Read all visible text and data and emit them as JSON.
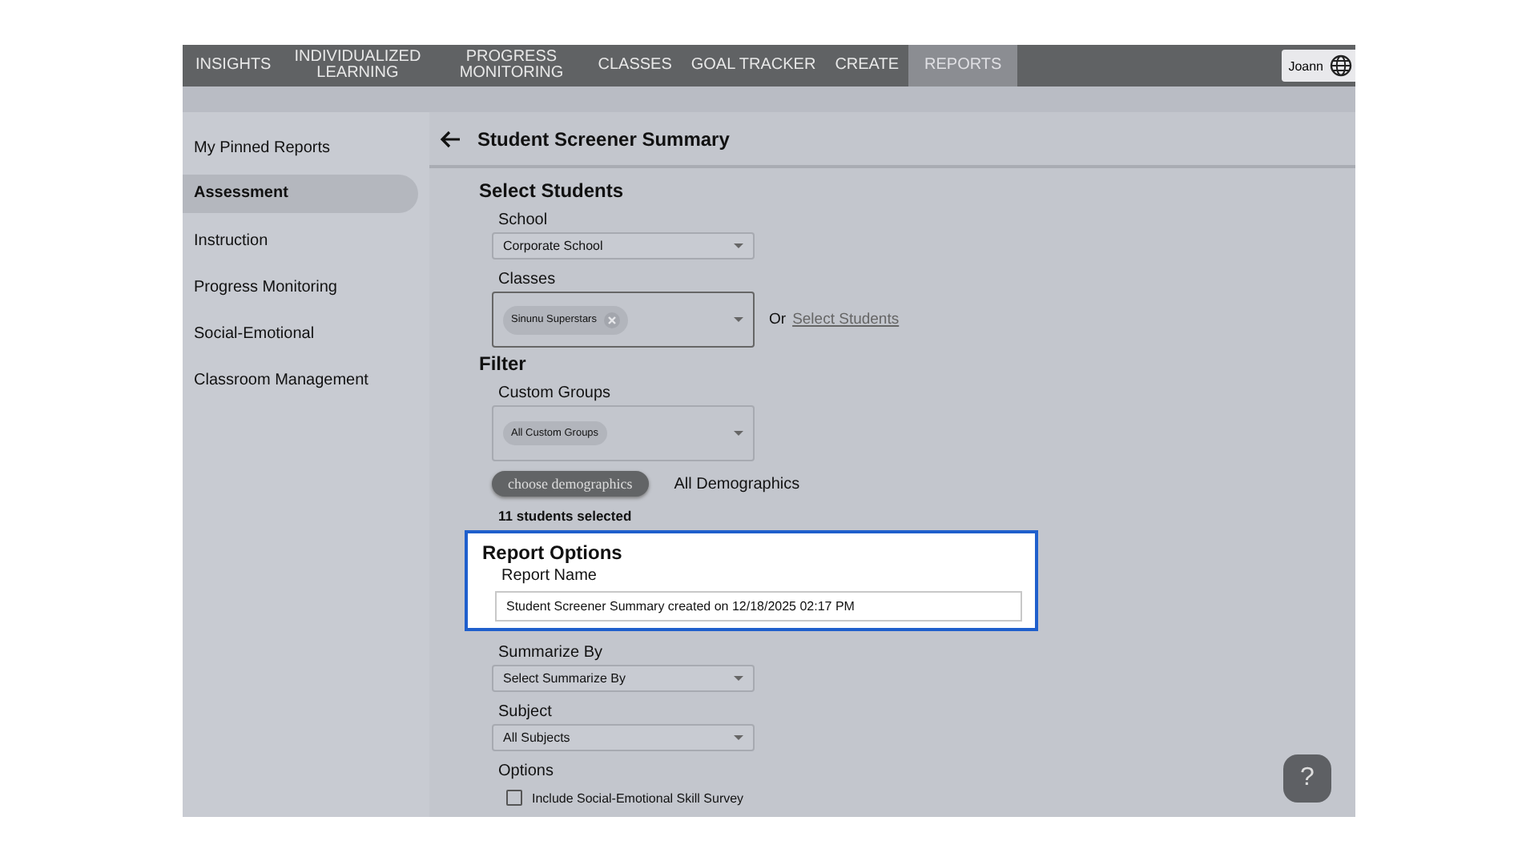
{
  "nav": {
    "tabs": [
      {
        "label": "INSIGHTS",
        "selected": false
      },
      {
        "label": "INDIVIDUALIZED LEARNING",
        "selected": false
      },
      {
        "label": "PROGRESS MONITORING",
        "selected": false
      },
      {
        "label": "CLASSES",
        "selected": false
      },
      {
        "label": "GOAL TRACKER",
        "selected": false
      },
      {
        "label": "CREATE",
        "selected": false
      },
      {
        "label": "REPORTS",
        "selected": true
      }
    ],
    "user": "Joann"
  },
  "sidebar": {
    "items": [
      {
        "label": "My Pinned Reports",
        "selected": false
      },
      {
        "label": "Assessment",
        "selected": true
      },
      {
        "label": "Instruction",
        "selected": false
      },
      {
        "label": "Progress Monitoring",
        "selected": false
      },
      {
        "label": "Social-Emotional",
        "selected": false
      },
      {
        "label": "Classroom Management",
        "selected": false
      }
    ]
  },
  "page_title": "Student Screener Summary",
  "select_students": {
    "heading": "Select Students",
    "school": {
      "label": "School",
      "value": "Corporate School"
    },
    "classes": {
      "label": "Classes",
      "chip": "Sinunu Superstars"
    },
    "or_text": "Or",
    "select_link": "Select Students"
  },
  "filter": {
    "heading": "Filter",
    "custom_groups": {
      "label": "Custom Groups",
      "chip": "All Custom Groups"
    },
    "demographics_button": "choose demographics",
    "demographics_value": "All Demographics",
    "selected_count": "11 students selected"
  },
  "report_options": {
    "heading": "Report Options",
    "highlighted": true,
    "report_name": {
      "label": "Report Name",
      "value": "Student Screener Summary created on 12/18/2025 02:17 PM"
    }
  },
  "summarize_by": {
    "label": "Summarize By",
    "value": "Select Summarize By"
  },
  "subject": {
    "label": "Subject",
    "value": "All Subjects"
  },
  "options": {
    "label": "Options",
    "items": [
      {
        "label": "Include Social-Emotional Skill Survey",
        "checked": false
      }
    ]
  },
  "help_button": "?"
}
